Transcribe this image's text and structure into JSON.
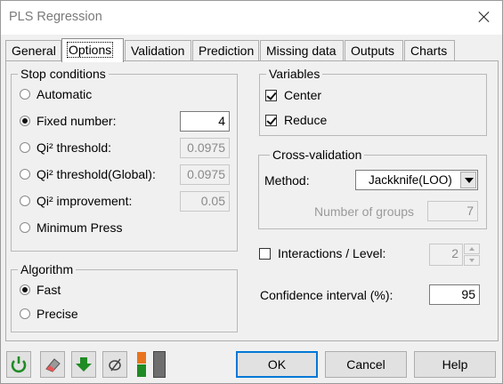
{
  "window": {
    "title": "PLS Regression"
  },
  "tabs": [
    {
      "label": "General"
    },
    {
      "label": "Options"
    },
    {
      "label": "Validation"
    },
    {
      "label": "Prediction"
    },
    {
      "label": "Missing data"
    },
    {
      "label": "Outputs"
    },
    {
      "label": "Charts"
    }
  ],
  "active_tab": "Options",
  "stop_conditions": {
    "title": "Stop conditions",
    "automatic": {
      "label": "Automatic",
      "checked": false
    },
    "fixed_number": {
      "label": "Fixed number:",
      "checked": true,
      "value": "4"
    },
    "qi2_threshold": {
      "label": "Qi² threshold:",
      "checked": false,
      "value": "0.0975"
    },
    "qi2_threshold_global": {
      "label": "Qi² threshold(Global):",
      "checked": false,
      "value": "0.0975"
    },
    "qi2_improvement": {
      "label": "Qi² improvement:",
      "checked": false,
      "value": "0.05"
    },
    "minimum_press": {
      "label": "Minimum Press",
      "checked": false
    }
  },
  "algorithm": {
    "title": "Algorithm",
    "fast": {
      "label": "Fast",
      "checked": true
    },
    "precise": {
      "label": "Precise",
      "checked": false
    }
  },
  "variables": {
    "title": "Variables",
    "center": {
      "label": "Center",
      "checked": true
    },
    "reduce": {
      "label": "Reduce",
      "checked": true
    }
  },
  "cross_validation": {
    "title": "Cross-validation",
    "method_label": "Method:",
    "method_value": "Jackknife(LOO)",
    "groups_label": "Number of groups",
    "groups_value": "7"
  },
  "interactions": {
    "label": "Interactions / Level:",
    "checked": false,
    "value": "2"
  },
  "confidence": {
    "label": "Confidence interval (%):",
    "value": "95"
  },
  "buttons": {
    "ok": "OK",
    "cancel": "Cancel",
    "help": "Help"
  },
  "icons": [
    "reset-icon",
    "eraser-icon",
    "download-arrow-icon",
    "settings-tool-icon",
    "split-color-icon"
  ],
  "colors": {
    "accent": "#0078d7",
    "green": "#1f8b24",
    "orange": "#e8741e"
  }
}
